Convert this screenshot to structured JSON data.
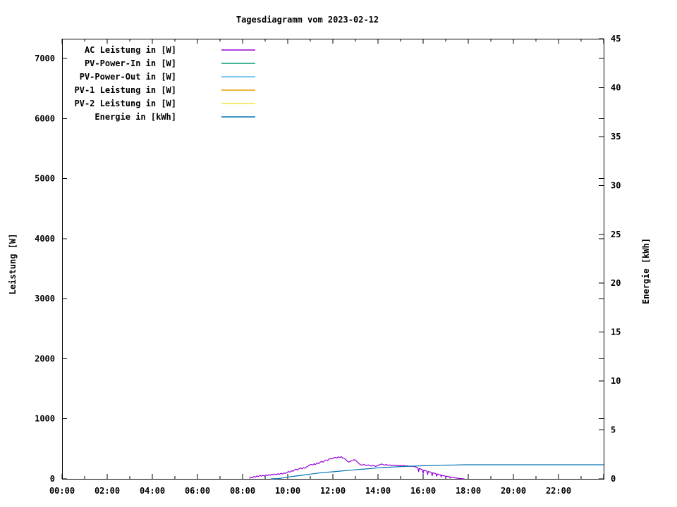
{
  "title": "Tagesdiagramm vom 2023-02-12",
  "colors": {
    "foreground": "#000000",
    "background": "#ffffff"
  },
  "axes": {
    "left": {
      "label": "Leistung [W]",
      "min": 0,
      "max": 7330,
      "ticks": [
        0,
        1000,
        2000,
        3000,
        4000,
        5000,
        6000,
        7000
      ]
    },
    "right": {
      "label": "Energie [kWh]",
      "min": 0,
      "max": 45,
      "ticks": [
        0,
        5,
        10,
        15,
        20,
        25,
        30,
        35,
        40,
        45
      ]
    },
    "x": {
      "min": 0,
      "max": 24,
      "minor_step_hours": 1,
      "ticks": [
        {
          "h": 0,
          "label": "00:00"
        },
        {
          "h": 2,
          "label": "02:00"
        },
        {
          "h": 4,
          "label": "04:00"
        },
        {
          "h": 6,
          "label": "06:00"
        },
        {
          "h": 8,
          "label": "08:00"
        },
        {
          "h": 10,
          "label": "10:00"
        },
        {
          "h": 12,
          "label": "12:00"
        },
        {
          "h": 14,
          "label": "14:00"
        },
        {
          "h": 16,
          "label": "16:00"
        },
        {
          "h": 18,
          "label": "18:00"
        },
        {
          "h": 20,
          "label": "20:00"
        },
        {
          "h": 22,
          "label": "22:00"
        }
      ]
    }
  },
  "chart_data": {
    "type": "line",
    "title": "Tagesdiagramm vom 2023-02-12",
    "x_unit": "hour of day",
    "xlim": [
      0,
      24
    ],
    "grid": false,
    "legend_position": "top-left inside plot",
    "y_left": {
      "label": "Leistung [W]",
      "lim": [
        0,
        7330
      ]
    },
    "y_right": {
      "label": "Energie [kWh]",
      "lim": [
        0,
        45
      ]
    },
    "notes": "Only 'AC Leistung' (noisy bump, ~08:20-17:50, peak ~370 W around 12:15) and 'Energie' (cumulative, reaching ~1.44 kWh) are visibly non-zero; the other four series are not visible (~0 W).",
    "series": [
      {
        "name": "AC Leistung in [W]",
        "axis": "left",
        "color": "#9400D3",
        "points": [
          [
            8.3,
            5
          ],
          [
            8.37,
            28
          ],
          [
            8.43,
            16
          ],
          [
            8.5,
            40
          ],
          [
            8.57,
            26
          ],
          [
            8.63,
            50
          ],
          [
            8.7,
            36
          ],
          [
            8.77,
            58
          ],
          [
            8.83,
            44
          ],
          [
            8.9,
            60
          ],
          [
            8.97,
            48
          ],
          [
            9.03,
            66
          ],
          [
            9.1,
            54
          ],
          [
            9.17,
            70
          ],
          [
            9.23,
            58
          ],
          [
            9.3,
            76
          ],
          [
            9.37,
            64
          ],
          [
            9.43,
            80
          ],
          [
            9.5,
            68
          ],
          [
            9.57,
            86
          ],
          [
            9.63,
            74
          ],
          [
            9.7,
            92
          ],
          [
            9.77,
            82
          ],
          [
            9.83,
            98
          ],
          [
            9.9,
            90
          ],
          [
            9.97,
            106
          ],
          [
            10.03,
            122
          ],
          [
            10.1,
            110
          ],
          [
            10.17,
            135
          ],
          [
            10.23,
            125
          ],
          [
            10.3,
            148
          ],
          [
            10.37,
            162
          ],
          [
            10.43,
            146
          ],
          [
            10.5,
            168
          ],
          [
            10.57,
            182
          ],
          [
            10.63,
            166
          ],
          [
            10.7,
            188
          ],
          [
            10.77,
            176
          ],
          [
            10.83,
            198
          ],
          [
            10.9,
            212
          ],
          [
            10.97,
            228
          ],
          [
            11.03,
            242
          ],
          [
            11.1,
            230
          ],
          [
            11.17,
            250
          ],
          [
            11.23,
            238
          ],
          [
            11.3,
            265
          ],
          [
            11.37,
            252
          ],
          [
            11.43,
            275
          ],
          [
            11.5,
            290
          ],
          [
            11.57,
            278
          ],
          [
            11.63,
            302
          ],
          [
            11.7,
            315
          ],
          [
            11.77,
            305
          ],
          [
            11.83,
            328
          ],
          [
            11.9,
            340
          ],
          [
            11.97,
            332
          ],
          [
            12.03,
            350
          ],
          [
            12.1,
            358
          ],
          [
            12.17,
            346
          ],
          [
            12.23,
            366
          ],
          [
            12.3,
            355
          ],
          [
            12.37,
            370
          ],
          [
            12.43,
            350
          ],
          [
            12.5,
            338
          ],
          [
            12.57,
            322
          ],
          [
            12.63,
            296
          ],
          [
            12.7,
            280
          ],
          [
            12.77,
            290
          ],
          [
            12.83,
            302
          ],
          [
            12.9,
            312
          ],
          [
            12.97,
            320
          ],
          [
            13.03,
            300
          ],
          [
            13.1,
            276
          ],
          [
            13.17,
            250
          ],
          [
            13.23,
            236
          ],
          [
            13.3,
            226
          ],
          [
            13.37,
            242
          ],
          [
            13.43,
            230
          ],
          [
            13.5,
            220
          ],
          [
            13.57,
            232
          ],
          [
            13.63,
            222
          ],
          [
            13.7,
            212
          ],
          [
            13.77,
            226
          ],
          [
            13.83,
            216
          ],
          [
            13.9,
            206
          ],
          [
            13.97,
            218
          ],
          [
            14.03,
            230
          ],
          [
            14.1,
            240
          ],
          [
            14.17,
            248
          ],
          [
            14.23,
            236
          ],
          [
            14.3,
            228
          ],
          [
            14.37,
            240
          ],
          [
            14.43,
            226
          ],
          [
            14.5,
            232
          ],
          [
            14.57,
            222
          ],
          [
            14.63,
            230
          ],
          [
            14.7,
            220
          ],
          [
            14.77,
            228
          ],
          [
            14.83,
            218
          ],
          [
            14.9,
            226
          ],
          [
            14.97,
            216
          ],
          [
            15.03,
            224
          ],
          [
            15.1,
            214
          ],
          [
            15.17,
            222
          ],
          [
            15.23,
            212
          ],
          [
            15.3,
            218
          ],
          [
            15.37,
            208
          ],
          [
            15.43,
            214
          ],
          [
            15.5,
            205
          ],
          [
            15.57,
            210
          ],
          [
            15.63,
            200
          ],
          [
            15.7,
            195
          ],
          [
            15.77,
            182
          ],
          [
            15.8,
            120
          ],
          [
            15.83,
            172
          ],
          [
            15.9,
            162
          ],
          [
            15.97,
            150
          ],
          [
            16.0,
            90
          ],
          [
            16.03,
            145
          ],
          [
            16.1,
            138
          ],
          [
            16.17,
            128
          ],
          [
            16.2,
            70
          ],
          [
            16.23,
            122
          ],
          [
            16.3,
            115
          ],
          [
            16.37,
            106
          ],
          [
            16.4,
            52
          ],
          [
            16.43,
            100
          ],
          [
            16.5,
            94
          ],
          [
            16.57,
            86
          ],
          [
            16.6,
            40
          ],
          [
            16.63,
            80
          ],
          [
            16.7,
            74
          ],
          [
            16.77,
            66
          ],
          [
            16.8,
            32
          ],
          [
            16.83,
            60
          ],
          [
            16.9,
            54
          ],
          [
            16.97,
            48
          ],
          [
            17.0,
            24
          ],
          [
            17.03,
            44
          ],
          [
            17.1,
            38
          ],
          [
            17.17,
            32
          ],
          [
            17.2,
            12
          ],
          [
            17.23,
            28
          ],
          [
            17.3,
            24
          ],
          [
            17.37,
            20
          ],
          [
            17.43,
            16
          ],
          [
            17.5,
            12
          ],
          [
            17.57,
            9
          ],
          [
            17.63,
            6
          ],
          [
            17.7,
            4
          ],
          [
            17.77,
            2
          ],
          [
            17.83,
            1
          ]
        ]
      },
      {
        "name": "PV-Power-In in [W]",
        "axis": "left",
        "color": "#009E73",
        "points": []
      },
      {
        "name": "PV-Power-Out in [W]",
        "axis": "left",
        "color": "#56B4E9",
        "points": []
      },
      {
        "name": "PV-1 Leistung in [W]",
        "axis": "left",
        "color": "#E69F00",
        "points": []
      },
      {
        "name": "PV-2 Leistung in [W]",
        "axis": "left",
        "color": "#F0E442",
        "points": []
      },
      {
        "name": "Energie in [kWh]",
        "axis": "right",
        "color": "#0072B2",
        "points": [
          [
            9.25,
            0
          ],
          [
            9.6,
            0.03
          ],
          [
            9.9,
            0.13
          ],
          [
            10.1,
            0.21
          ],
          [
            10.33,
            0.28
          ],
          [
            10.67,
            0.38
          ],
          [
            11.0,
            0.48
          ],
          [
            11.33,
            0.58
          ],
          [
            11.67,
            0.66
          ],
          [
            12.0,
            0.72
          ],
          [
            12.33,
            0.79
          ],
          [
            12.67,
            0.86
          ],
          [
            13.0,
            0.93
          ],
          [
            13.33,
            0.99
          ],
          [
            13.67,
            1.05
          ],
          [
            14.0,
            1.12
          ],
          [
            14.33,
            1.17
          ],
          [
            14.67,
            1.21
          ],
          [
            15.0,
            1.25
          ],
          [
            15.33,
            1.28
          ],
          [
            15.67,
            1.31
          ],
          [
            16.0,
            1.34
          ],
          [
            16.33,
            1.36
          ],
          [
            16.67,
            1.38
          ],
          [
            17.0,
            1.4
          ],
          [
            17.33,
            1.41
          ],
          [
            17.67,
            1.43
          ],
          [
            18.0,
            1.44
          ],
          [
            19.0,
            1.44
          ],
          [
            20.0,
            1.44
          ],
          [
            21.0,
            1.44
          ],
          [
            22.0,
            1.44
          ],
          [
            23.0,
            1.44
          ],
          [
            24.0,
            1.44
          ]
        ]
      }
    ]
  }
}
